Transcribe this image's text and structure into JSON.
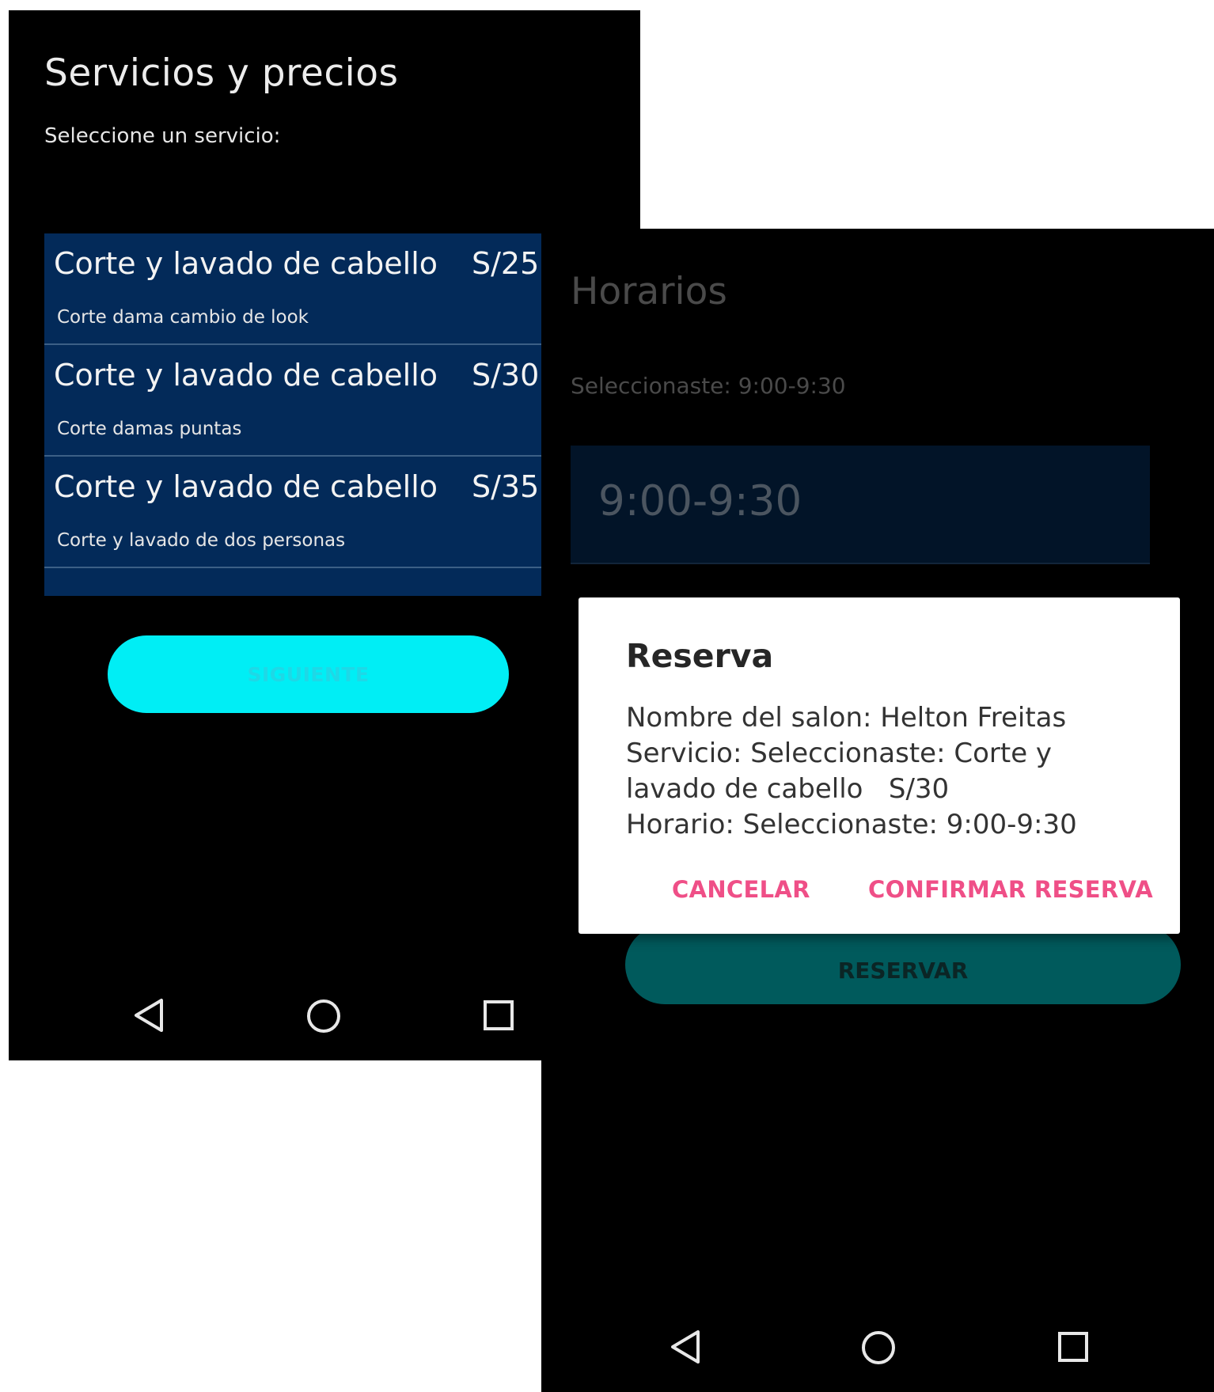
{
  "screen1": {
    "title": "Servicios y precios",
    "subtitle": "Seleccione un servicio:",
    "services": [
      {
        "name": "Corte y lavado de cabello",
        "price": "S/25",
        "description": "Corte dama cambio de look"
      },
      {
        "name": "Corte y lavado de cabello",
        "price": "S/30",
        "description": "Corte damas puntas"
      },
      {
        "name": "Corte y lavado de cabello",
        "price": "S/35",
        "description": "Corte y lavado de dos personas"
      }
    ],
    "next_button": "SIGUIENTE"
  },
  "screen2": {
    "title": "Horarios",
    "selected_text": "Seleccionaste: 9:00-9:30",
    "time_slots": [
      "9:00-9:30"
    ],
    "reserve_button": "RESERVAR",
    "dialog": {
      "title": "Reserva",
      "lines": [
        "Nombre del salon: Helton Freitas",
        "Servicio: Seleccionaste: Corte y",
        "lavado de cabello   S/30",
        "Horario: Seleccionaste: 9:00-9:30"
      ],
      "cancel": "CANCELAR",
      "confirm": "CONFIRMAR RESERVA"
    }
  },
  "colors": {
    "list_bg": "#032a59",
    "next_button": "#00eef5",
    "reserve_button": "#005a5c",
    "dialog_action": "#ef4f87"
  },
  "icons": [
    "back-icon",
    "home-icon",
    "recents-icon"
  ]
}
